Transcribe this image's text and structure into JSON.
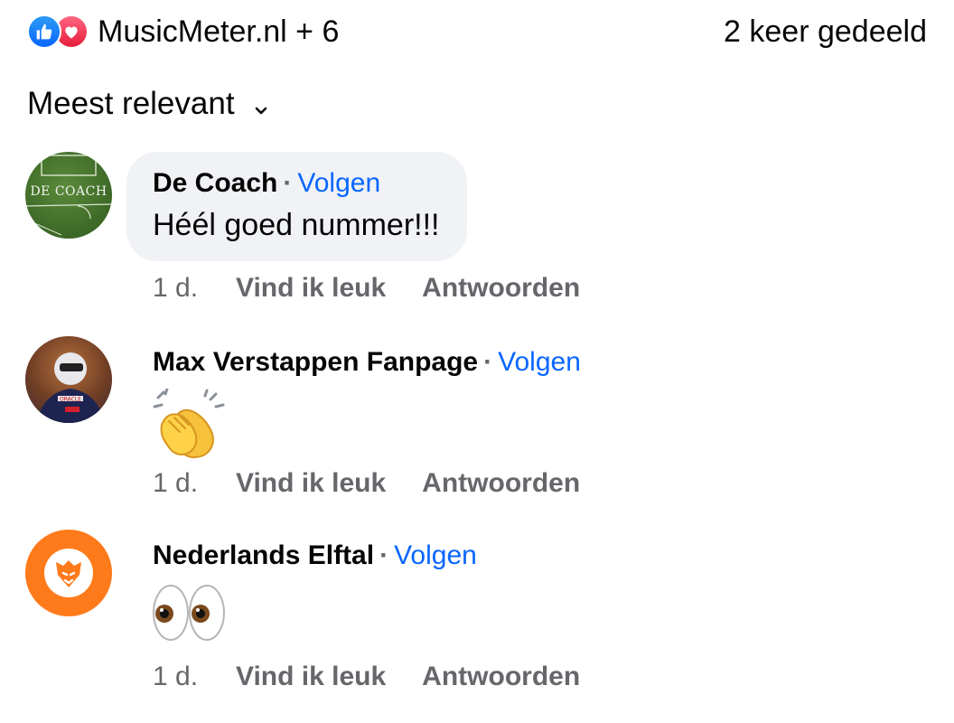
{
  "header": {
    "reaction_icons": [
      "like-icon",
      "love-icon"
    ],
    "reaction_summary": "MusicMeter.nl + 6",
    "shares_label": "2 keer gedeeld"
  },
  "sort": {
    "label": "Meest relevant",
    "icon": "chevron-down-icon"
  },
  "comments": [
    {
      "author": "De Coach",
      "follow_label": "Volgen",
      "text": "Héél goed nummer!!!",
      "avatar_text": "DE COACH",
      "time": "1 d.",
      "like_label": "Vind ik leuk",
      "reply_label": "Antwoorden"
    },
    {
      "author": "Max Verstappen Fanpage",
      "follow_label": "Volgen",
      "emoji": "clapping-hands",
      "time": "1 d.",
      "like_label": "Vind ik leuk",
      "reply_label": "Antwoorden"
    },
    {
      "author": "Nederlands Elftal",
      "follow_label": "Volgen",
      "emoji": "eyes",
      "time": "1 d.",
      "like_label": "Vind ik leuk",
      "reply_label": "Antwoorden"
    }
  ],
  "colors": {
    "link": "#0866ff",
    "meta": "#65676b",
    "bubble": "#f0f2f5",
    "orange": "#ff7a1a"
  }
}
